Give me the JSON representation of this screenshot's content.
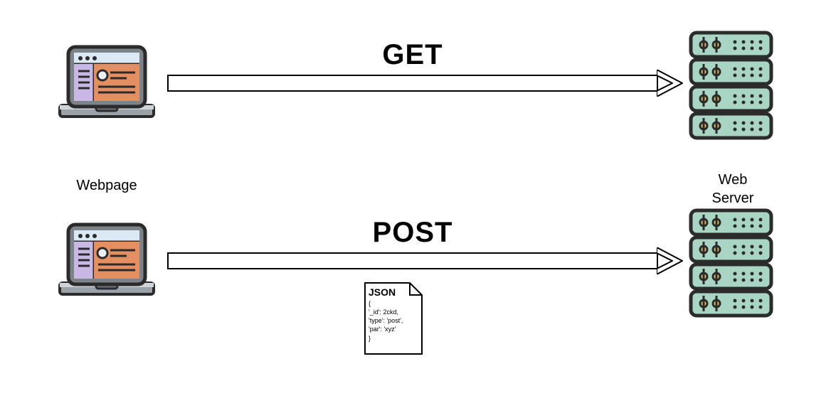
{
  "diagram": {
    "client_label": "Webpage",
    "server_label": "Web Server",
    "rows": [
      {
        "method": "GET",
        "has_payload": false
      },
      {
        "method": "POST",
        "has_payload": true
      }
    ],
    "payload": {
      "title": "JSON",
      "lines": [
        "{",
        "'_id': 2ckd,",
        "'type': 'post',",
        "'par': 'xyz'",
        "}"
      ]
    }
  }
}
